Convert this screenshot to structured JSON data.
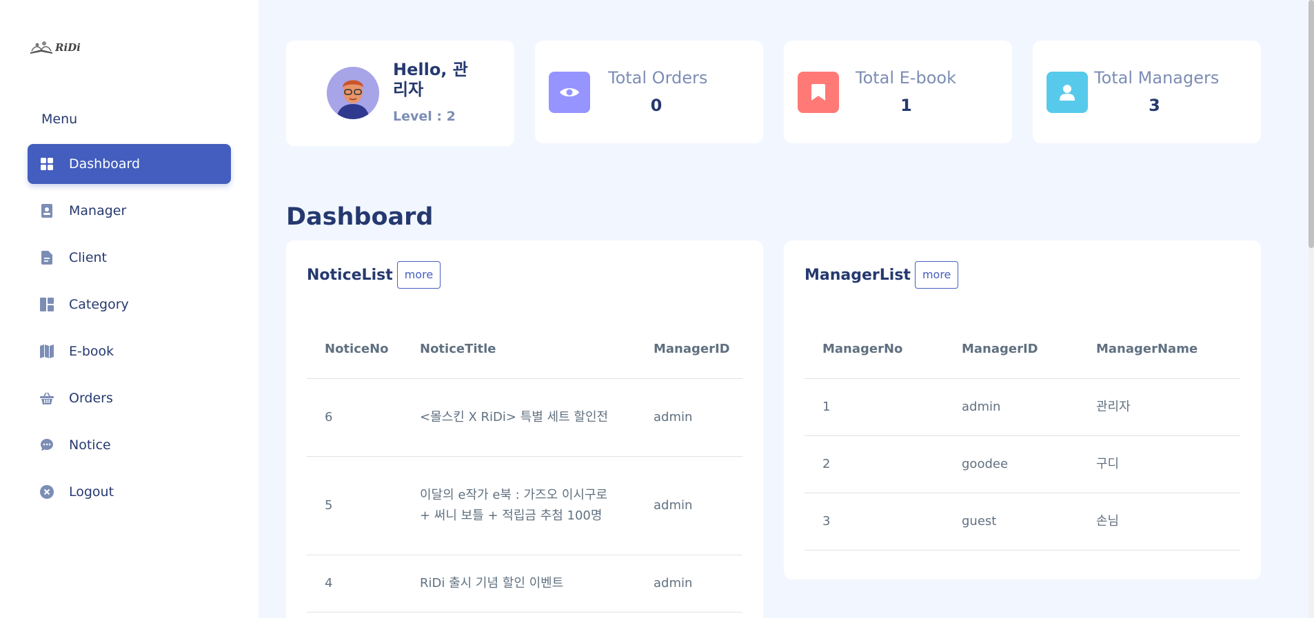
{
  "logo": {
    "text": "RiDi"
  },
  "sidebar": {
    "menu_title": "Menu",
    "items": [
      {
        "label": "Dashboard",
        "icon": "grid-icon",
        "active": true
      },
      {
        "label": "Manager",
        "icon": "badge-icon",
        "active": false
      },
      {
        "label": "Client",
        "icon": "file-icon",
        "active": false
      },
      {
        "label": "Category",
        "icon": "layout-icon",
        "active": false
      },
      {
        "label": "E-book",
        "icon": "map-icon",
        "active": false
      },
      {
        "label": "Orders",
        "icon": "basket-icon",
        "active": false
      },
      {
        "label": "Notice",
        "icon": "chat-icon",
        "active": false
      },
      {
        "label": "Logout",
        "icon": "x-circle-icon",
        "active": false
      }
    ]
  },
  "profile": {
    "greeting": "Hello, 관리자",
    "level": "Level : 2"
  },
  "stats": {
    "orders": {
      "title": "Total Orders",
      "value": "0",
      "color": "#9694ff"
    },
    "ebook": {
      "title": "Total E-book",
      "value": "1",
      "color": "#ff7976"
    },
    "managers": {
      "title": "Total Managers",
      "value": "3",
      "color": "#57caeb"
    }
  },
  "main": {
    "title": "Dashboard"
  },
  "notice_list": {
    "title": "NoticeList",
    "more": "more",
    "headers": [
      "NoticeNo",
      "NoticeTitle",
      "ManagerID"
    ],
    "rows": [
      {
        "no": "6",
        "title": "<몰스킨 X RiDi> 특별 세트 할인전",
        "manager": "admin"
      },
      {
        "no": "5",
        "title": "이달의 e작가 e북 : 가즈오 이시구로 + 써니 보틀 + 적립금 추첨 100명",
        "manager": "admin"
      },
      {
        "no": "4",
        "title": "RiDi 출시 기념 할인 이벤트",
        "manager": "admin"
      }
    ]
  },
  "manager_list": {
    "title": "ManagerList",
    "more": "more",
    "headers": [
      "ManagerNo",
      "ManagerID",
      "ManagerName"
    ],
    "rows": [
      {
        "no": "1",
        "id": "admin",
        "name": "관리자"
      },
      {
        "no": "2",
        "id": "goodee",
        "name": "구디"
      },
      {
        "no": "3",
        "id": "guest",
        "name": "손님"
      }
    ]
  }
}
